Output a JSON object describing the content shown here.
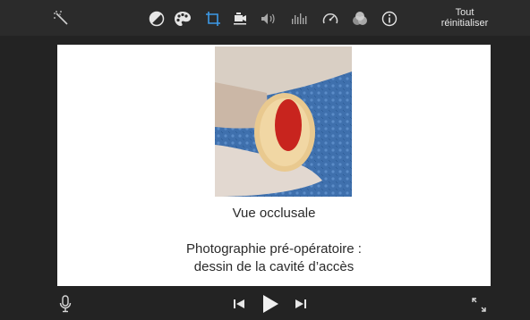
{
  "toolbar": {
    "tools": [
      {
        "icon": "magic-wand-icon"
      },
      {
        "icon": "color-balance-icon"
      },
      {
        "icon": "color-palette-icon"
      },
      {
        "icon": "crop-icon",
        "active": true
      },
      {
        "icon": "stabilization-camera-icon"
      },
      {
        "icon": "volume-icon"
      },
      {
        "icon": "equalizer-icon"
      },
      {
        "icon": "speed-gauge-icon"
      },
      {
        "icon": "filter-overlay-icon"
      },
      {
        "icon": "info-icon"
      }
    ],
    "reset_line1": "Tout",
    "reset_line2": "réinitialiser",
    "accent_color": "#3d9ae8"
  },
  "slide": {
    "caption": "Vue occlusale",
    "description_line1": "Photographie pré-opératoire :",
    "description_line2": "dessin de la cavité d’accès",
    "marker_color": "#c8241e"
  },
  "playback": {
    "controls": [
      "microphone-icon",
      "skip-back-icon",
      "play-icon",
      "skip-forward-icon",
      "fullscreen-icon"
    ]
  }
}
